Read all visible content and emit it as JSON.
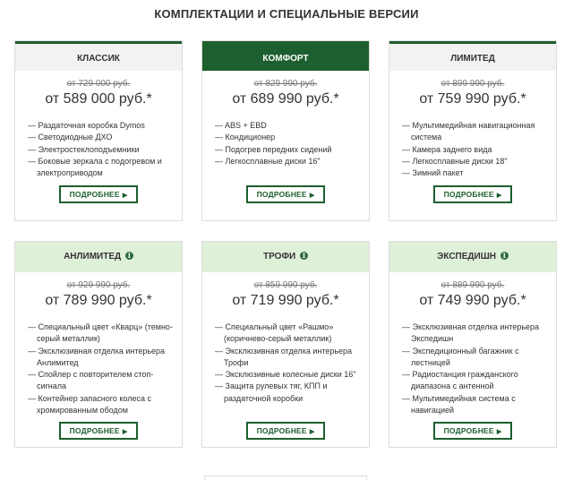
{
  "section_title": "КОМПЛЕКТАЦИИ И СПЕЦИАЛЬНЫЕ ВЕРСИИ",
  "more_label": "ПОДРОБНЕЕ",
  "cards": [
    {
      "name": "КЛАССИК",
      "old_price": "от 729 000 руб.",
      "new_price": "от 589 000 руб.*",
      "features": [
        "Раздаточная коробка Dymos",
        "Светодиодные ДХО",
        "Электростеклоподъемники",
        "Боковые зеркала с подогревом и электроприводом"
      ]
    },
    {
      "name": "КОМФОРТ",
      "old_price": "от 829 990 руб.",
      "new_price": "от 689 990 руб.*",
      "features": [
        "ABS + EBD",
        "Кондиционер",
        "Подогрев передних сидений",
        "Легкосплавные диски 16\""
      ]
    },
    {
      "name": "ЛИМИТЕД",
      "old_price": "от 899 990 руб.",
      "new_price": "от 759 990 руб.*",
      "features": [
        "Мультимедийная навигационная система",
        "Камера заднего вида",
        "Легкосплавные диски 18\"",
        "Зимний пакет"
      ]
    },
    {
      "name": "АНЛИМИТЕД",
      "old_price": "от 929 990 руб.",
      "new_price": "от 789 990 руб.*",
      "features": [
        "Специальный цвет «Кварц» (темно-серый металлик)",
        "Эксклюзивная отделка интерьера Анлимитед",
        "Спойлер с повторителем стоп-сигнала",
        "Контейнер запасного колеса с хромированным ободом"
      ]
    },
    {
      "name": "ТРОФИ",
      "old_price": "от 859 990 руб.",
      "new_price": "от 719 990 руб.*",
      "features": [
        "Специальный цвет «Рашмо» (коричнево-серый металлик)",
        "Эксклюзивная отделка интерьера Трофи",
        "Эксклюзивные колесные диски 16\"",
        "Защита рулевых тяг, КПП и раздаточной коробки"
      ]
    },
    {
      "name": "ЭКСПЕДИШН",
      "old_price": "от 889 990 руб.",
      "new_price": "от 749 990 руб.*",
      "features": [
        "Эксклюзивная отделка интерьера Экспедишн",
        "Экспедиционный багажник с лестницей",
        "Радиостанция гражданского диапазона с антенной",
        "Мультимедийная система с навигацией"
      ]
    }
  ]
}
